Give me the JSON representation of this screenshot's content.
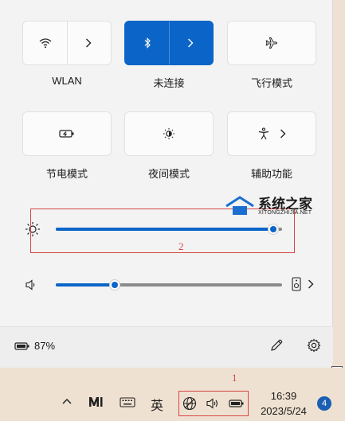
{
  "tiles": [
    {
      "label": "WLAN",
      "left_icon": "wifi-icon",
      "right_icon": "chevron-right-icon",
      "active": false
    },
    {
      "label": "未连接",
      "left_icon": "bluetooth-icon",
      "right_icon": "chevron-right-icon",
      "active": true
    },
    {
      "label": "飞行模式",
      "icon": "airplane-icon",
      "active": false
    },
    {
      "label": "节电模式",
      "icon": "battery-saver-icon",
      "active": false
    },
    {
      "label": "夜间模式",
      "icon": "night-light-icon",
      "active": false
    },
    {
      "label": "辅助功能",
      "icon": "accessibility-icon",
      "right_icon": "chevron-right-icon",
      "active": false
    }
  ],
  "brightness": {
    "icon": "sun-icon",
    "value_fraction": 0.96
  },
  "volume": {
    "icon": "speaker-icon",
    "value_fraction": 0.26,
    "output_icon": "speaker-device-icon"
  },
  "footer": {
    "battery_percent": "87%",
    "edit_icon": "pencil-icon",
    "settings_icon": "gear-icon"
  },
  "annotations": {
    "box1_label": "1",
    "box2_label": "2"
  },
  "watermark": {
    "title": "系统之家",
    "subtitle": "XITONGZHIJIA.NET"
  },
  "taskbar": {
    "tray_chevron_icon": "chevron-up-icon",
    "app_icon": "m-logo-icon",
    "keyboard_icon": "keyboard-icon",
    "ime_label": "英",
    "network_icon": "globe-icon",
    "volume_icon": "volume-icon",
    "battery_icon": "battery-icon",
    "time": "16:39",
    "date": "2023/5/24",
    "notification_count": "4",
    "accent": "#1a5fb4"
  }
}
